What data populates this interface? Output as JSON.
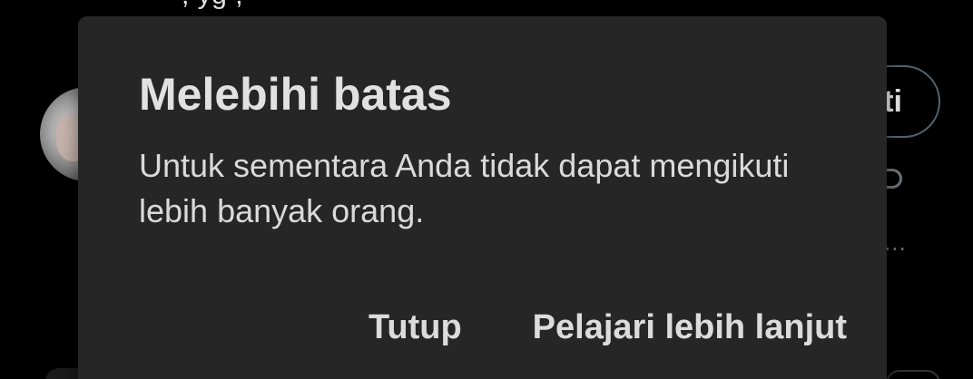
{
  "background": {
    "top_text": ", yg       ,",
    "follow_button_label": "ti",
    "ellipsis": "..."
  },
  "dialog": {
    "title": "Melebihi batas",
    "message": "Untuk sementara Anda tidak dapat mengikuti lebih banyak orang.",
    "close_label": "Tutup",
    "learn_more_label": "Pelajari lebih lanjut"
  },
  "colors": {
    "page_background": "#000000",
    "dialog_background": "#262626",
    "text_primary": "#e1e1e1"
  }
}
